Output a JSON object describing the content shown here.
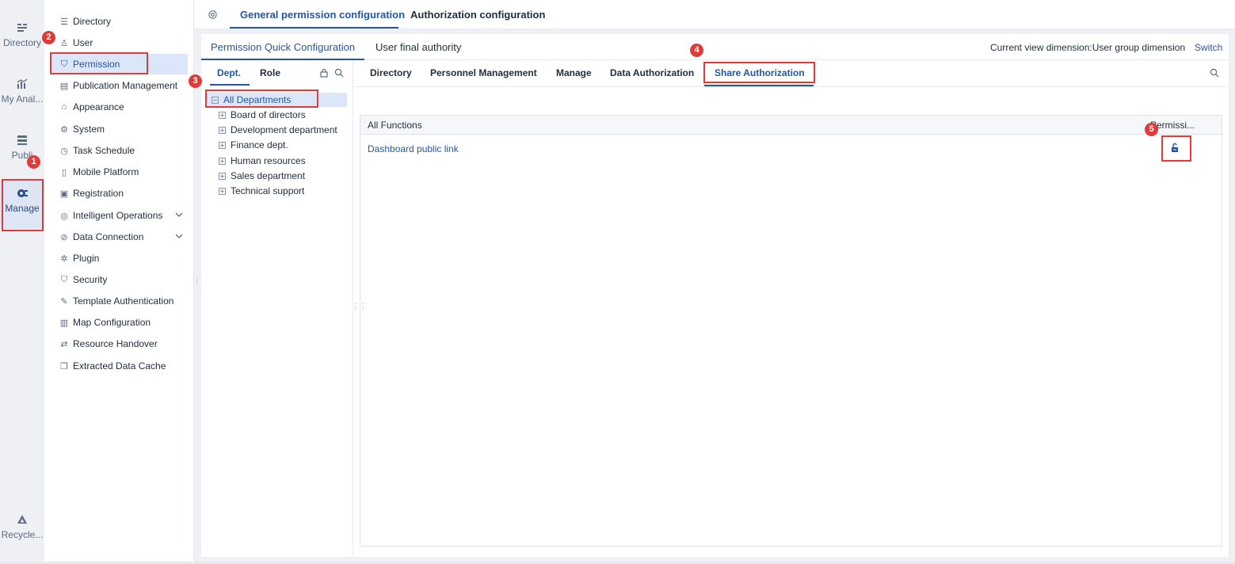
{
  "rail": {
    "items": [
      {
        "label": "Directory",
        "icon": "list-icon"
      },
      {
        "label": "My Anal...",
        "icon": "chart-icon"
      },
      {
        "label": "Publi",
        "icon": "stack-icon"
      },
      {
        "label": "Manage",
        "icon": "manage-gear-icon"
      },
      {
        "label": "Recycle...",
        "icon": "recycle-icon"
      }
    ]
  },
  "sidebar": {
    "items": [
      {
        "label": "Directory",
        "icon": "directory-icon"
      },
      {
        "label": "User",
        "icon": "user-icon"
      },
      {
        "label": "Permission",
        "icon": "permission-shield-icon"
      },
      {
        "label": "Publication Management",
        "icon": "publication-icon"
      },
      {
        "label": "Appearance",
        "icon": "appearance-icon"
      },
      {
        "label": "System",
        "icon": "system-gear-icon"
      },
      {
        "label": "Task Schedule",
        "icon": "clock-icon"
      },
      {
        "label": "Mobile Platform",
        "icon": "mobile-icon"
      },
      {
        "label": "Registration",
        "icon": "registration-icon"
      },
      {
        "label": "Intelligent Operations",
        "icon": "operations-icon"
      },
      {
        "label": "Data Connection",
        "icon": "link-icon"
      },
      {
        "label": "Plugin",
        "icon": "plugin-icon"
      },
      {
        "label": "Security",
        "icon": "security-shield-icon"
      },
      {
        "label": "Template Authentication",
        "icon": "template-icon"
      },
      {
        "label": "Map Configuration",
        "icon": "map-icon"
      },
      {
        "label": "Resource Handover",
        "icon": "handover-icon"
      },
      {
        "label": "Extracted Data Cache",
        "icon": "cache-icon"
      }
    ],
    "active_index": 2
  },
  "topbar": {
    "tabs": [
      {
        "label": "General permission configuration"
      },
      {
        "label": "Authorization configuration"
      }
    ],
    "active_index": 0
  },
  "main": {
    "sub_tabs": [
      {
        "label": "Permission Quick Configuration"
      },
      {
        "label": "User final authority"
      }
    ],
    "view_dimension": "Current view dimension:User group dimension",
    "switch_label": "Switch",
    "tree_tabs": [
      {
        "label": "Dept."
      },
      {
        "label": "Role"
      }
    ],
    "tree": [
      {
        "label": "All Departments",
        "expanded": true,
        "level": 0
      },
      {
        "label": "Board of directors",
        "expanded": false,
        "level": 1
      },
      {
        "label": "Development department",
        "expanded": false,
        "level": 1
      },
      {
        "label": "Finance dept.",
        "expanded": false,
        "level": 1
      },
      {
        "label": "Human resources",
        "expanded": false,
        "level": 1
      },
      {
        "label": "Sales department",
        "expanded": false,
        "level": 1
      },
      {
        "label": "Technical support",
        "expanded": false,
        "level": 1
      }
    ],
    "function_tabs": [
      {
        "label": "Directory"
      },
      {
        "label": "Personnel Management"
      },
      {
        "label": "Manage"
      },
      {
        "label": "Data Authorization"
      },
      {
        "label": "Share Authorization"
      }
    ],
    "function_active_index": 4,
    "grid": {
      "columns": [
        "All Functions",
        "Permissi..."
      ],
      "rows": [
        {
          "name": "Dashboard public link",
          "permission_icon": "unlock-icon"
        }
      ]
    }
  },
  "annotations": [
    "1",
    "2",
    "3",
    "4",
    "5"
  ],
  "colors": {
    "accent": "#2456a6",
    "annotation": "#e03b3b",
    "selected_bg": "#dbe6f8"
  }
}
